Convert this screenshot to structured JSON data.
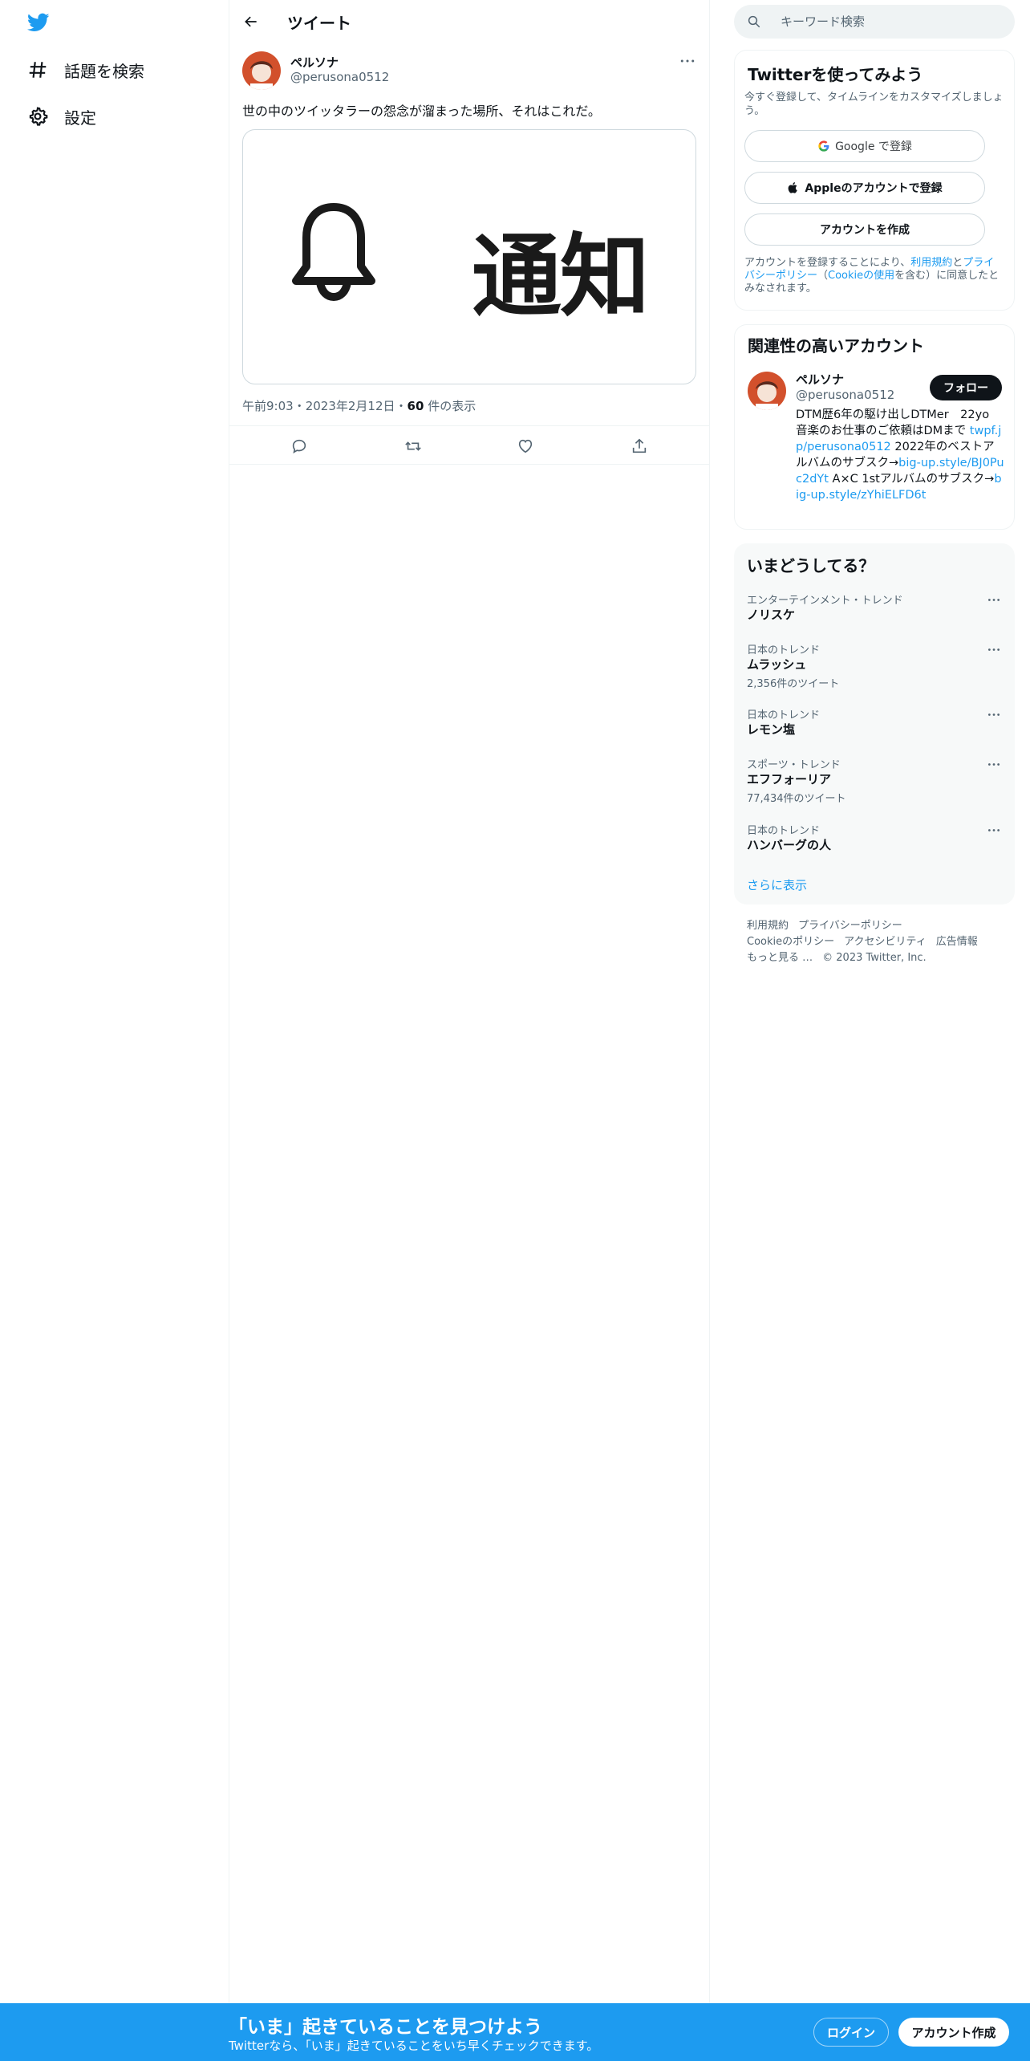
{
  "colors": {
    "brand": "#1d9bf0",
    "text": "#0f1419",
    "muted": "#536471"
  },
  "nav": {
    "logo_icon": "twitter-bird-icon",
    "items": [
      {
        "icon": "hashtag-icon",
        "label": "話題を検索"
      },
      {
        "icon": "gear-icon",
        "label": "設定"
      }
    ]
  },
  "main": {
    "title": "ツイート",
    "tweet": {
      "name": "ペルソナ",
      "handle": "@perusona0512",
      "text": "世の中のツイッタラーの怨念が溜まった場所、それはこれだ。",
      "media_text": "通知",
      "media_icon": "bell-icon",
      "time": "午前9:03",
      "date": "2023年2月12日",
      "views_count": "60",
      "views_label": "件の表示",
      "sep": "・"
    }
  },
  "search": {
    "placeholder": "キーワード検索"
  },
  "signup": {
    "title": "Twitterを使ってみよう",
    "desc": "今すぐ登録して、タイムラインをカスタマイズしましょう。",
    "google_label": "Google で登録",
    "apple_label": "Appleのアカウントで登録",
    "create_label": "アカウントを作成",
    "legal_prefix": "アカウントを登録することにより、",
    "legal_terms": "利用規約",
    "legal_and": "と",
    "legal_privacy": "プライバシーポリシー",
    "legal_cookie_open": "（",
    "legal_cookie": "Cookieの使用",
    "legal_suffix": "を含む）に同意したとみなされます。"
  },
  "related": {
    "title": "関連性の高いアカウント",
    "name": "ペルソナ",
    "handle": "@perusona0512",
    "follow_label": "フォロー",
    "bio_1": "DTM歴6年の駆け出しDTMer　22yo 音楽のお仕事のご依頼はDMまで ",
    "bio_link_1": "twpf.jp/perusona0512",
    "bio_2": " 2022年のベストアルバムのサブスク→",
    "bio_link_2": "big-up.style/BJ0Puc2dYt",
    "bio_3": " A×C 1stアルバムのサブスク→",
    "bio_link_3": "big-up.style/zYhiELFD6t"
  },
  "trends": {
    "title": "いまどうしてる？",
    "items": [
      {
        "category": "エンターテインメント・トレンド",
        "name": "ノリスケ",
        "count": ""
      },
      {
        "category": "日本のトレンド",
        "name": "ムラッシュ",
        "count": "2,356件のツイート"
      },
      {
        "category": "日本のトレンド",
        "name": "レモン塩",
        "count": ""
      },
      {
        "category": "スポーツ・トレンド",
        "name": "エフフォーリア",
        "count": "77,434件のツイート"
      },
      {
        "category": "日本のトレンド",
        "name": "ハンバーグの人",
        "count": ""
      }
    ],
    "show_more": "さらに表示"
  },
  "footer": {
    "links": [
      "利用規約",
      "プライバシーポリシー",
      "Cookieのポリシー",
      "アクセシビリティ",
      "広告情報",
      "もっと見る …"
    ],
    "copyright": "© 2023 Twitter, Inc."
  },
  "bottom_bar": {
    "title": "「いま」起きていることを見つけよう",
    "subtitle": "Twitterなら、「いま」起きていることをいち早くチェックできます。",
    "login_label": "ログイン",
    "signup_label": "アカウント作成"
  }
}
